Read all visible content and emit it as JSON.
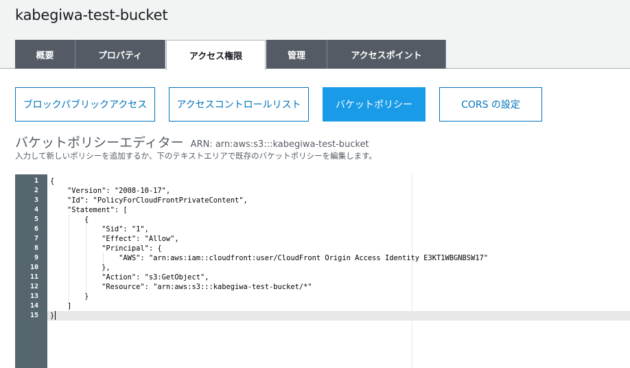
{
  "bucket": {
    "name": "kabegiwa-test-bucket"
  },
  "tabs": [
    {
      "label": "概要"
    },
    {
      "label": "プロパティ"
    },
    {
      "label": "アクセス権限"
    },
    {
      "label": "管理"
    },
    {
      "label": "アクセスポイント"
    }
  ],
  "active_tab_index": 2,
  "sub_nav": [
    {
      "label": "ブロックパブリックアクセス"
    },
    {
      "label": "アクセスコントロールリスト"
    },
    {
      "label": "バケットポリシー"
    },
    {
      "label": "CORS の設定"
    }
  ],
  "active_sub_nav_index": 2,
  "editor": {
    "title": "バケットポリシーエディター",
    "arn_label": "ARN: arn:aws:s3:::kabegiwa-test-bucket",
    "description": "入力して新しいポリシーを追加するか、下のテキストエリアで既存のバケットポリシーを編集します。",
    "current_line": 15,
    "lines": [
      "{",
      "    \"Version\": \"2008-10-17\",",
      "    \"Id\": \"PolicyForCloudFrontPrivateContent\",",
      "    \"Statement\": [",
      "        {",
      "            \"Sid\": \"1\",",
      "            \"Effect\": \"Allow\",",
      "            \"Principal\": {",
      "                \"AWS\": \"arn:aws:iam::cloudfront:user/CloudFront Origin Access Identity E3KT1WBGNBSW17\"",
      "            },",
      "            \"Action\": \"s3:GetObject\",",
      "            \"Resource\": \"arn:aws:s3:::kabegiwa-test-bucket/*\"",
      "        }",
      "    ]",
      "}"
    ]
  },
  "colors": {
    "tab_bg": "#545b64",
    "accent": "#0073bb",
    "active_button": "#1a9be8",
    "gutter": "#56666e"
  }
}
